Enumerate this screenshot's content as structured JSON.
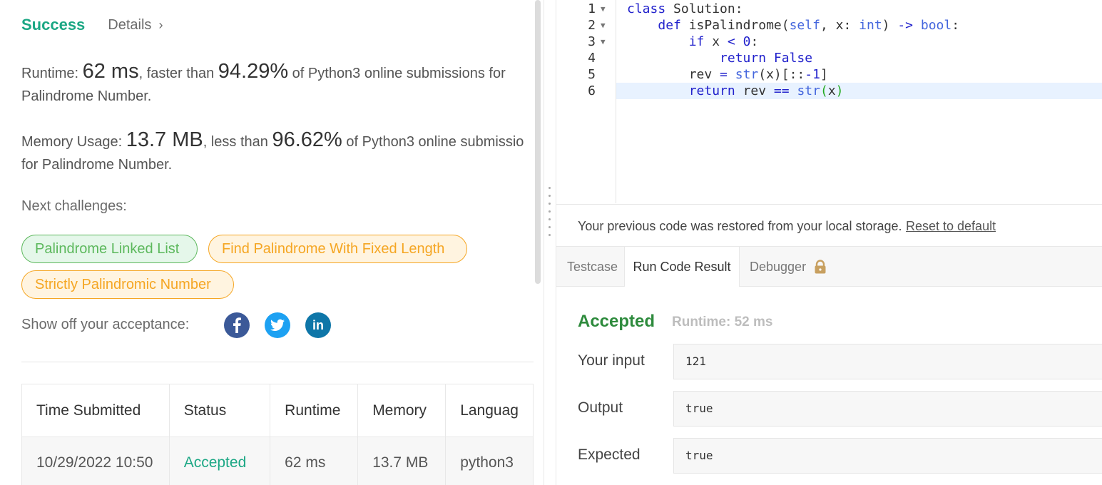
{
  "header": {
    "status": "Success",
    "details_label": "Details"
  },
  "stats": {
    "runtime_label": "Runtime:",
    "runtime_value": "62 ms",
    "runtime_mid": ", faster than",
    "runtime_pct": "94.29%",
    "runtime_tail": " of Python3 online submissions for",
    "runtime_tail2": "Palindrome Number.",
    "memory_label": "Memory Usage:",
    "memory_value": "13.7 MB",
    "memory_mid": ", less than",
    "memory_pct": "96.62%",
    "memory_tail": " of Python3 online submissio",
    "memory_tail2": "for Palindrome Number."
  },
  "next_challenges": {
    "label": "Next challenges:",
    "items": [
      {
        "label": "Palindrome Linked List",
        "difficulty_color": "#5cb85c"
      },
      {
        "label": "Find Palindrome With Fixed Length",
        "difficulty_color": "#f5a623"
      },
      {
        "label": "Strictly Palindromic Number",
        "difficulty_color": "#f5a623"
      }
    ]
  },
  "share": {
    "label": "Show off your acceptance:",
    "icons": [
      "facebook-icon",
      "twitter-icon",
      "linkedin-icon"
    ]
  },
  "submissions": {
    "headers": [
      "Time Submitted",
      "Status",
      "Runtime",
      "Memory",
      "Languag"
    ],
    "rows": [
      {
        "time": "10/29/2022 10:50",
        "status": "Accepted",
        "runtime": "62 ms",
        "memory": "13.7 MB",
        "language": "python3"
      }
    ]
  },
  "editor": {
    "line_numbers": [
      "1",
      "2",
      "3",
      "4",
      "5",
      "6"
    ],
    "highlighted_line": 6
  },
  "restore": {
    "message": "Your previous code was restored from your local storage.",
    "reset_label": "Reset to default"
  },
  "tabs": {
    "testcase": "Testcase",
    "run_result": "Run Code Result",
    "debugger": "Debugger"
  },
  "result": {
    "status": "Accepted",
    "runtime": "Runtime: 52 ms",
    "input_label": "Your input",
    "input_value": "121",
    "output_label": "Output",
    "output_value": "true",
    "expected_label": "Expected",
    "expected_value": "true"
  },
  "colors": {
    "success": "#1ba784",
    "accepted_result": "#2e8b3d",
    "easy": "#5cb85c",
    "medium": "#f5a623",
    "facebook": "#3b5998",
    "twitter": "#1da1f2",
    "linkedin": "#0e76a8"
  }
}
